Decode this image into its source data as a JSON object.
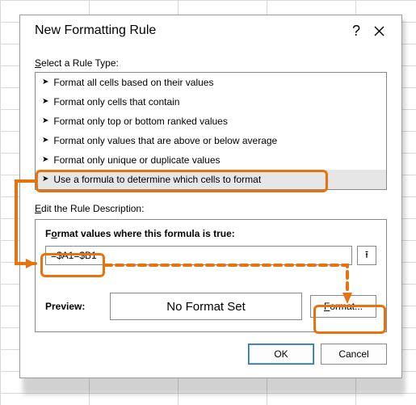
{
  "dialog": {
    "title": "New Formatting Rule",
    "help_glyph": "?",
    "rule_type_label_pre": "S",
    "rule_type_label_rest": "elect a Rule Type:",
    "rules": [
      "Format all cells based on their values",
      "Format only cells that contain",
      "Format only top or bottom ranked values",
      "Format only values that are above or below average",
      "Format only unique or duplicate values",
      "Use a formula to determine which cells to format"
    ],
    "edit_label_pre": "E",
    "edit_label_rest": "dit the Rule Description:",
    "formula_heading_pre": "F",
    "formula_heading_u": "o",
    "formula_heading_rest": "rmat values where this formula is true:",
    "formula_value": "=$A1=$B1",
    "collapse_glyph": "⭱",
    "preview_label": "Preview:",
    "preview_text": "No Format Set",
    "format_btn_u": "F",
    "format_btn_rest": "ormat...",
    "ok_label": "OK",
    "cancel_label": "Cancel"
  }
}
